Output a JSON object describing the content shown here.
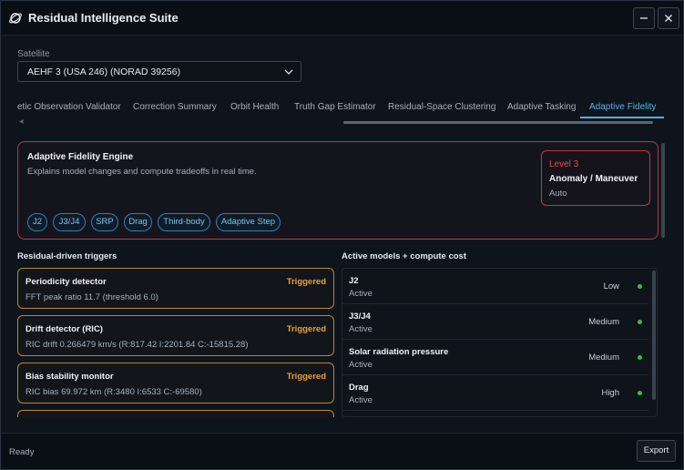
{
  "app": {
    "title": "Residual Intelligence Suite",
    "icon": "satellite-orbit-icon"
  },
  "window_controls": {
    "minimize_icon": "minimize-icon",
    "close_icon": "close-icon"
  },
  "satellite": {
    "label": "Satellite",
    "selected": "AEHF 3 (USA 246) (NORAD 39256)"
  },
  "tabs": [
    {
      "label": "etic Observation Validator"
    },
    {
      "label": "Correction Summary"
    },
    {
      "label": "Orbit Health"
    },
    {
      "label": "Truth Gap Estimator"
    },
    {
      "label": "Residual-Space Clustering"
    },
    {
      "label": "Adaptive Tasking"
    },
    {
      "label": "Adaptive Fidelity",
      "active": true
    }
  ],
  "engine": {
    "title": "Adaptive Fidelity Engine",
    "description": "Explains model changes and compute tradeoffs in real time.",
    "level": {
      "name": "Level 3",
      "kind": "Anomaly / Maneuver",
      "mode": "Auto"
    },
    "chips": [
      "J2",
      "J3/J4",
      "SRP",
      "Drag",
      "Third-body",
      "Adaptive Step"
    ]
  },
  "triggers": {
    "title": "Residual-driven triggers",
    "items": [
      {
        "name": "Periodicity detector",
        "status": "Triggered",
        "detail": "FFT peak ratio 11.7 (threshold 6.0)"
      },
      {
        "name": "Drift detector (RIC)",
        "status": "Triggered",
        "detail": "RIC drift 0.266479 km/s (R:817.42 I:2201.84 C:-15815.28)"
      },
      {
        "name": "Bias stability monitor",
        "status": "Triggered",
        "detail": "RIC bias 69.972 km (R:3480 I:6533 C:-69580)"
      }
    ]
  },
  "models": {
    "title": "Active models + compute cost",
    "items": [
      {
        "name": "J2",
        "state": "Active",
        "cost": "Low"
      },
      {
        "name": "J3/J4",
        "state": "Active",
        "cost": "Medium"
      },
      {
        "name": "Solar radiation pressure",
        "state": "Active",
        "cost": "Medium"
      },
      {
        "name": "Drag",
        "state": "Active",
        "cost": "High"
      }
    ]
  },
  "colors": {
    "accent": "#4fb3e8",
    "alert": "#e5484d",
    "warning": "#e7a13a",
    "ok": "#3fb950"
  },
  "footer": {
    "status": "Ready",
    "export_label": "Export"
  }
}
